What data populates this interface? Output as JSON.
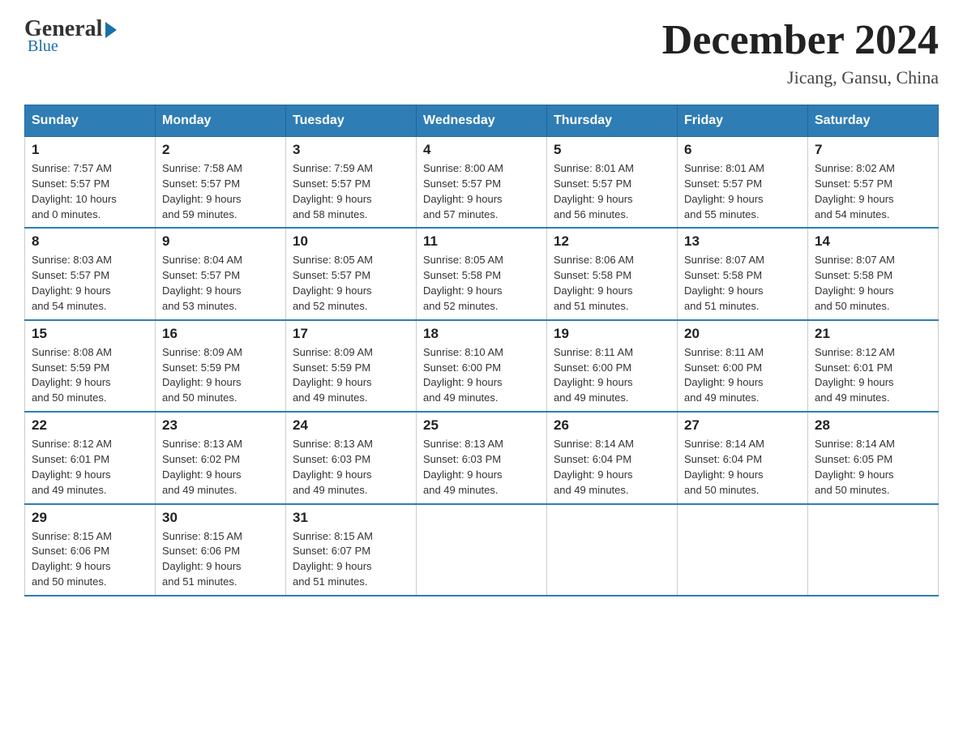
{
  "logo": {
    "general": "General",
    "blue": "Blue"
  },
  "header": {
    "title": "December 2024",
    "location": "Jicang, Gansu, China"
  },
  "days_of_week": [
    "Sunday",
    "Monday",
    "Tuesday",
    "Wednesday",
    "Thursday",
    "Friday",
    "Saturday"
  ],
  "weeks": [
    [
      {
        "day": "1",
        "sunrise": "7:57 AM",
        "sunset": "5:57 PM",
        "daylight": "10 hours and 0 minutes."
      },
      {
        "day": "2",
        "sunrise": "7:58 AM",
        "sunset": "5:57 PM",
        "daylight": "9 hours and 59 minutes."
      },
      {
        "day": "3",
        "sunrise": "7:59 AM",
        "sunset": "5:57 PM",
        "daylight": "9 hours and 58 minutes."
      },
      {
        "day": "4",
        "sunrise": "8:00 AM",
        "sunset": "5:57 PM",
        "daylight": "9 hours and 57 minutes."
      },
      {
        "day": "5",
        "sunrise": "8:01 AM",
        "sunset": "5:57 PM",
        "daylight": "9 hours and 56 minutes."
      },
      {
        "day": "6",
        "sunrise": "8:01 AM",
        "sunset": "5:57 PM",
        "daylight": "9 hours and 55 minutes."
      },
      {
        "day": "7",
        "sunrise": "8:02 AM",
        "sunset": "5:57 PM",
        "daylight": "9 hours and 54 minutes."
      }
    ],
    [
      {
        "day": "8",
        "sunrise": "8:03 AM",
        "sunset": "5:57 PM",
        "daylight": "9 hours and 54 minutes."
      },
      {
        "day": "9",
        "sunrise": "8:04 AM",
        "sunset": "5:57 PM",
        "daylight": "9 hours and 53 minutes."
      },
      {
        "day": "10",
        "sunrise": "8:05 AM",
        "sunset": "5:57 PM",
        "daylight": "9 hours and 52 minutes."
      },
      {
        "day": "11",
        "sunrise": "8:05 AM",
        "sunset": "5:58 PM",
        "daylight": "9 hours and 52 minutes."
      },
      {
        "day": "12",
        "sunrise": "8:06 AM",
        "sunset": "5:58 PM",
        "daylight": "9 hours and 51 minutes."
      },
      {
        "day": "13",
        "sunrise": "8:07 AM",
        "sunset": "5:58 PM",
        "daylight": "9 hours and 51 minutes."
      },
      {
        "day": "14",
        "sunrise": "8:07 AM",
        "sunset": "5:58 PM",
        "daylight": "9 hours and 50 minutes."
      }
    ],
    [
      {
        "day": "15",
        "sunrise": "8:08 AM",
        "sunset": "5:59 PM",
        "daylight": "9 hours and 50 minutes."
      },
      {
        "day": "16",
        "sunrise": "8:09 AM",
        "sunset": "5:59 PM",
        "daylight": "9 hours and 50 minutes."
      },
      {
        "day": "17",
        "sunrise": "8:09 AM",
        "sunset": "5:59 PM",
        "daylight": "9 hours and 49 minutes."
      },
      {
        "day": "18",
        "sunrise": "8:10 AM",
        "sunset": "6:00 PM",
        "daylight": "9 hours and 49 minutes."
      },
      {
        "day": "19",
        "sunrise": "8:11 AM",
        "sunset": "6:00 PM",
        "daylight": "9 hours and 49 minutes."
      },
      {
        "day": "20",
        "sunrise": "8:11 AM",
        "sunset": "6:00 PM",
        "daylight": "9 hours and 49 minutes."
      },
      {
        "day": "21",
        "sunrise": "8:12 AM",
        "sunset": "6:01 PM",
        "daylight": "9 hours and 49 minutes."
      }
    ],
    [
      {
        "day": "22",
        "sunrise": "8:12 AM",
        "sunset": "6:01 PM",
        "daylight": "9 hours and 49 minutes."
      },
      {
        "day": "23",
        "sunrise": "8:13 AM",
        "sunset": "6:02 PM",
        "daylight": "9 hours and 49 minutes."
      },
      {
        "day": "24",
        "sunrise": "8:13 AM",
        "sunset": "6:03 PM",
        "daylight": "9 hours and 49 minutes."
      },
      {
        "day": "25",
        "sunrise": "8:13 AM",
        "sunset": "6:03 PM",
        "daylight": "9 hours and 49 minutes."
      },
      {
        "day": "26",
        "sunrise": "8:14 AM",
        "sunset": "6:04 PM",
        "daylight": "9 hours and 49 minutes."
      },
      {
        "day": "27",
        "sunrise": "8:14 AM",
        "sunset": "6:04 PM",
        "daylight": "9 hours and 50 minutes."
      },
      {
        "day": "28",
        "sunrise": "8:14 AM",
        "sunset": "6:05 PM",
        "daylight": "9 hours and 50 minutes."
      }
    ],
    [
      {
        "day": "29",
        "sunrise": "8:15 AM",
        "sunset": "6:06 PM",
        "daylight": "9 hours and 50 minutes."
      },
      {
        "day": "30",
        "sunrise": "8:15 AM",
        "sunset": "6:06 PM",
        "daylight": "9 hours and 51 minutes."
      },
      {
        "day": "31",
        "sunrise": "8:15 AM",
        "sunset": "6:07 PM",
        "daylight": "9 hours and 51 minutes."
      },
      null,
      null,
      null,
      null
    ]
  ],
  "labels": {
    "sunrise": "Sunrise:",
    "sunset": "Sunset:",
    "daylight": "Daylight:"
  }
}
